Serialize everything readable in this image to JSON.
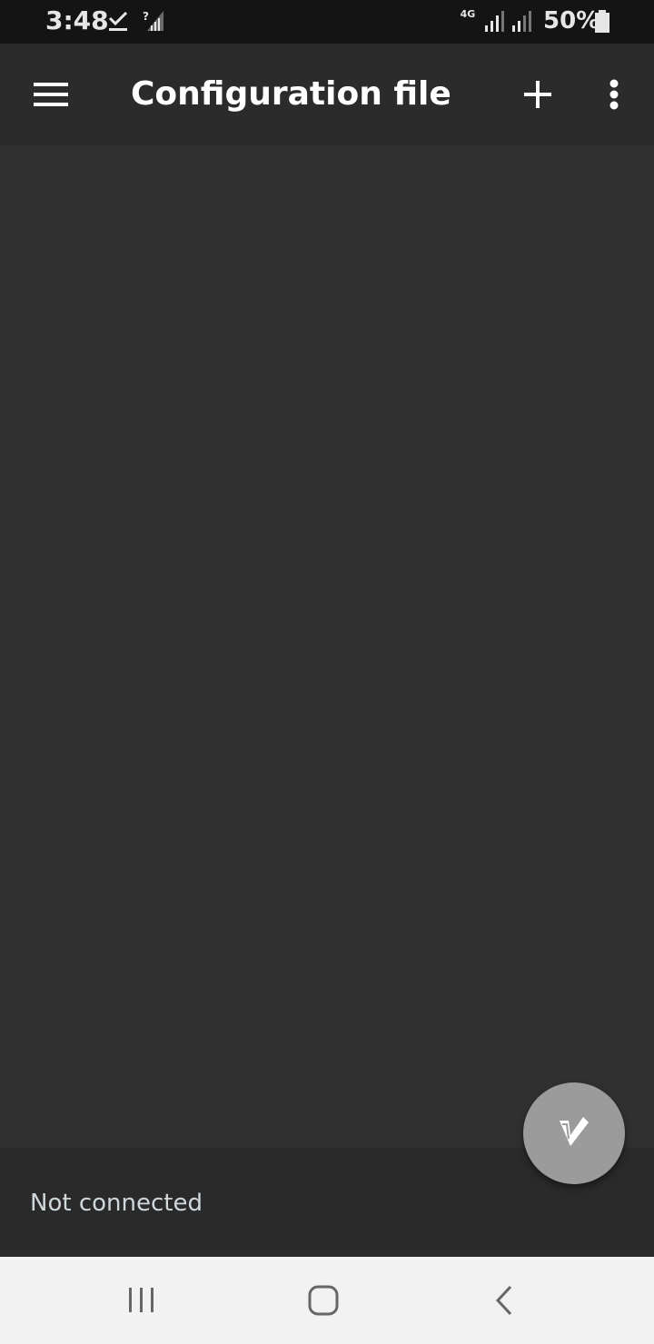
{
  "status_bar": {
    "time": "3:48",
    "network_type": "4G",
    "battery_percent": "50%",
    "icons": [
      "check-icon",
      "no-sim-icon",
      "signal-icon",
      "signal-icon",
      "battery-icon"
    ]
  },
  "app_bar": {
    "title": "Configuration file",
    "icons": [
      "menu-icon",
      "add-icon",
      "more-vert-icon"
    ]
  },
  "bottom_bar": {
    "connection_status": "Not connected"
  },
  "fab": {
    "icon": "v-logo-icon",
    "color": "#9b9b9b"
  },
  "nav_bar": {
    "icons": [
      "recents-icon",
      "home-icon",
      "back-icon"
    ]
  },
  "colors": {
    "background": "#303030",
    "app_bar": "#2b2b2b",
    "status_bar": "#141414",
    "bottom_bar": "#2a2a2a",
    "nav_bar": "#f2f2f2"
  }
}
